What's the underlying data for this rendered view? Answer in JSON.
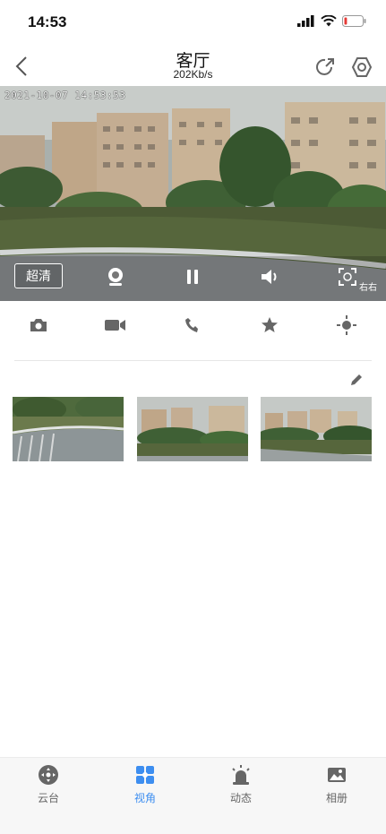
{
  "status_bar": {
    "time": "14:53"
  },
  "nav": {
    "title": "客厅",
    "bitrate": "202Kb/s",
    "back_icon": "chevron-left-icon",
    "share_icon": "share-icon",
    "settings_icon": "hexagon-settings-icon"
  },
  "video": {
    "osd_timestamp": "2021-10-07 14:53:53",
    "quality_label": "超清",
    "watermark_label": "右右",
    "battery_level": 0.15
  },
  "actions": [
    {
      "name": "snapshot",
      "icon": "camera-icon"
    },
    {
      "name": "record",
      "icon": "video-camera-icon"
    },
    {
      "name": "talk",
      "icon": "phone-icon"
    },
    {
      "name": "favorite",
      "icon": "star-icon"
    },
    {
      "name": "brightness",
      "icon": "light-icon"
    }
  ],
  "presets": [
    {
      "name": "preset-1"
    },
    {
      "name": "preset-2"
    },
    {
      "name": "preset-3"
    }
  ],
  "tabs": [
    {
      "label": "云台",
      "icon": "ptz-joystick-icon",
      "active": false
    },
    {
      "label": "视角",
      "icon": "view-angle-icon",
      "active": true
    },
    {
      "label": "动态",
      "icon": "alarm-light-icon",
      "active": false
    },
    {
      "label": "相册",
      "icon": "album-icon",
      "active": false
    }
  ],
  "colors": {
    "accent": "#3d8ef0",
    "icon_gray": "#666666",
    "tab_bg": "#f7f7f7",
    "battery_low": "#e53935"
  }
}
